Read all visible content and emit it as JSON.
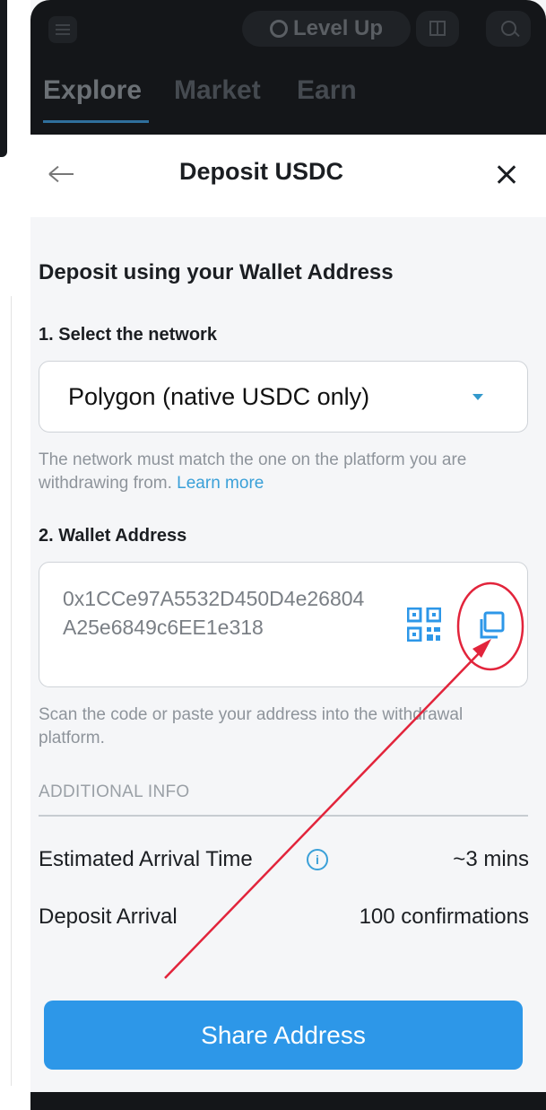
{
  "header": {
    "level_up_label": "Level Up",
    "tabs": [
      {
        "label": "Explore"
      },
      {
        "label": "Market"
      },
      {
        "label": "Earn"
      }
    ]
  },
  "sheet": {
    "title": "Deposit USDC",
    "section_title": "Deposit using your Wallet Address",
    "network": {
      "step_label": "1. Select the network",
      "selected_value": "Polygon (native USDC only)",
      "hint": "The network must match the one on the platform you are withdrawing from.",
      "learn_more": "Learn more"
    },
    "wallet": {
      "step_label": "2. Wallet Address",
      "address": "0x1CCe97A5532D450D4e26804A25e6849c6EE1e318",
      "hint": "Scan the code or paste your address into the withdrawal platform."
    },
    "additional_info": {
      "heading": "ADDITIONAL INFO",
      "rows": [
        {
          "label": "Estimated Arrival Time",
          "value": "~3 mins"
        },
        {
          "label": "Deposit Arrival",
          "value": "100 confirmations"
        }
      ]
    },
    "share_button": "Share Address"
  },
  "colors": {
    "accent": "#2d97e8",
    "link": "#3aa0d8",
    "annotation": "#e2243b",
    "topbar": "#141619"
  },
  "icons": [
    "menu-icon",
    "level-up-icon",
    "gift-icon",
    "search-icon",
    "back-arrow-icon",
    "close-icon",
    "chevron-down-icon",
    "qr-code-icon",
    "copy-icon",
    "info-icon"
  ]
}
